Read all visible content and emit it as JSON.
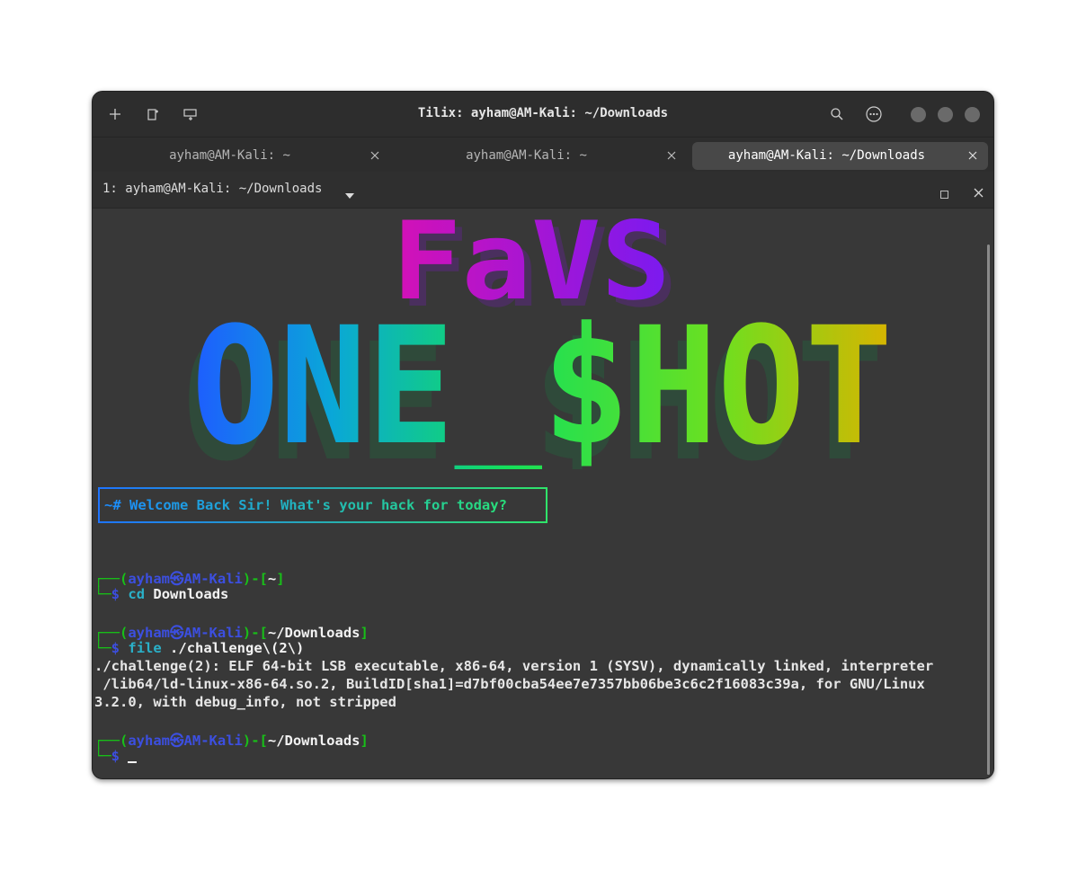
{
  "window": {
    "title": "Tilix: ayham@AM-Kali: ~/Downloads"
  },
  "titlebar": {
    "icons": [
      "plus-icon",
      "add-terminal-right-icon",
      "add-terminal-down-icon",
      "search-icon",
      "menu-dots-icon"
    ]
  },
  "tabs": [
    {
      "label": "ayham@AM-Kali: ~",
      "active": false
    },
    {
      "label": "ayham@AM-Kali: ~",
      "active": false
    },
    {
      "label": "ayham@AM-Kali: ~/Downloads",
      "active": true
    }
  ],
  "session": {
    "title": "1: ayham@AM-Kali: ~/Downloads"
  },
  "banner": {
    "top_text": "FaVS",
    "main_text": "ONE_$HOT"
  },
  "welcome": "~# Welcome Back Sir! What's your hack for today?",
  "prompt": {
    "corner_top": "┌──",
    "corner_bottom": "└─",
    "user": "ayham",
    "host": "AM-Kali",
    "at": "㉿",
    "dollar": "$"
  },
  "commands": [
    {
      "cwd": "~",
      "cmd": "cd",
      "arg": "Downloads"
    },
    {
      "cwd": "~/Downloads",
      "cmd": "file",
      "arg": "./challenge\\(2\\)"
    },
    {
      "cwd": "~/Downloads",
      "cmd": "",
      "arg": ""
    }
  ],
  "output": [
    "./challenge(2): ELF 64-bit LSB executable, x86-64, version 1 (SYSV), dynamically linked, interpreter",
    " /lib64/ld-linux-x86-64.so.2, BuildID[sha1]=d7bf00cba54ee7e7357bb06be3c6c2f16083c39a, for GNU/Linux",
    "3.2.0, with debug_info, not stripped"
  ],
  "colors": {
    "prompt_green": "#18c018",
    "prompt_blue": "#3c4fe0",
    "command_cyan": "#2ab0c8",
    "background": "#383838"
  }
}
